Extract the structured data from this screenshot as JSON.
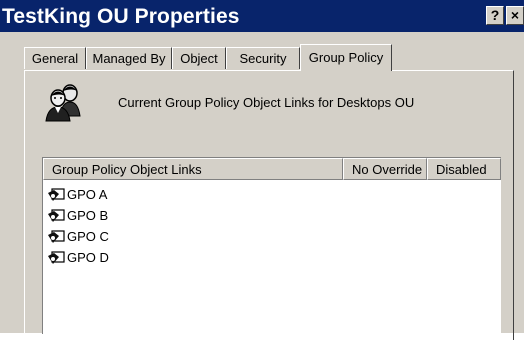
{
  "window": {
    "title": "TestKing OU Properties",
    "help_button": "?",
    "close_button": "×"
  },
  "tabs": [
    {
      "label": "General",
      "active": false
    },
    {
      "label": "Managed By",
      "active": false
    },
    {
      "label": "Object",
      "active": false
    },
    {
      "label": "Security",
      "active": false
    },
    {
      "label": "Group Policy",
      "active": true
    }
  ],
  "group_policy": {
    "header_icon": "users-icon",
    "header_text": "Current Group Policy Object Links for Desktops OU",
    "list": {
      "columns": [
        "Group Policy Object Links",
        "No Override",
        "Disabled"
      ],
      "rows": [
        {
          "name": "GPO A",
          "icon": "gpo-icon"
        },
        {
          "name": "GPO B",
          "icon": "gpo-icon"
        },
        {
          "name": "GPO C",
          "icon": "gpo-icon"
        },
        {
          "name": "GPO D",
          "icon": "gpo-icon"
        }
      ]
    }
  }
}
